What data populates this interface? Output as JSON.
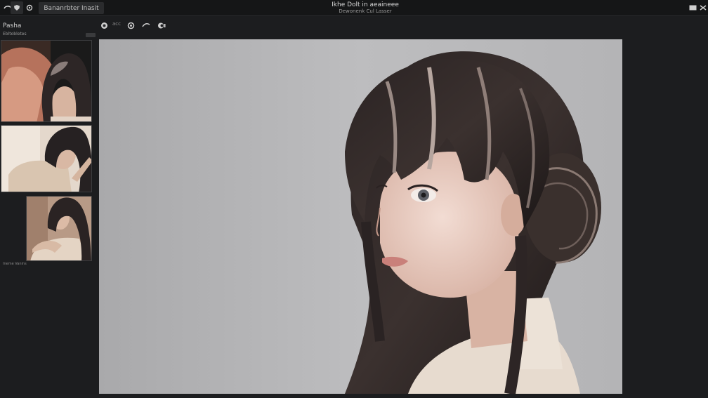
{
  "titlebar": {
    "tab_label": "Bananrbter Inasit",
    "title": "Ikhe Dolt in aeaineee",
    "subtitle": "Dewonenk Cul Lasser"
  },
  "toolbar": {
    "tool_label": "acc"
  },
  "panel": {
    "title": "Pasha",
    "subtitle": "Ebltobletes",
    "caption": "Ineme Vanins"
  },
  "colors": {
    "app_bg": "#1c1d1f",
    "titlebar_bg": "#151617",
    "canvas_bg": "#b3b3b5"
  }
}
